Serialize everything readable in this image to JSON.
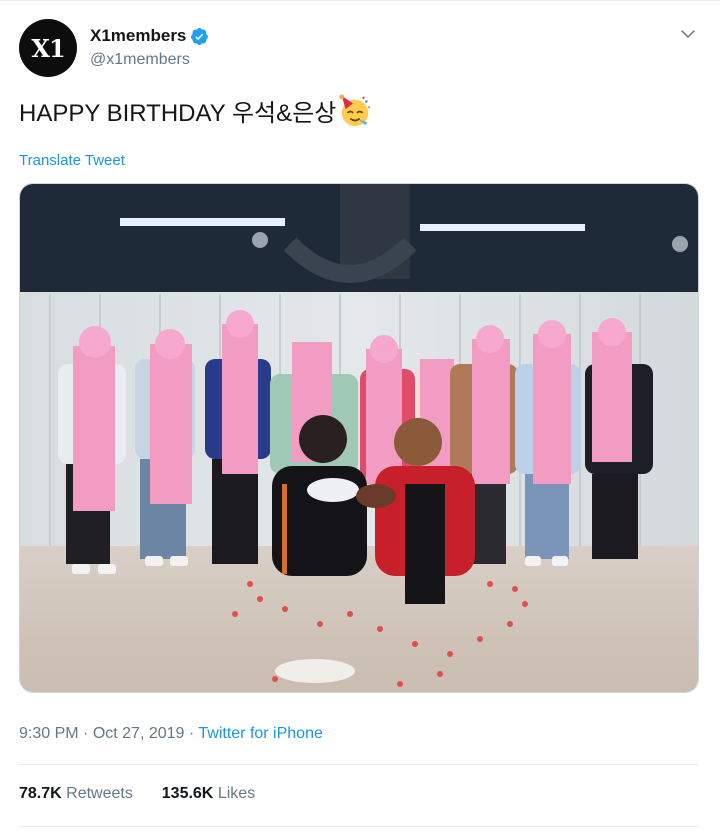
{
  "account": {
    "display_name": "X1members",
    "handle": "@x1members",
    "avatar_text": "X1"
  },
  "tweet": {
    "text": "HAPPY BIRTHDAY 우석&은상",
    "emoji": "partying-face-icon",
    "translate_label": "Translate Tweet",
    "time": "9:30 PM",
    "date": "Oct 27, 2019",
    "source": "Twitter for iPhone",
    "separator": " · "
  },
  "stats": {
    "retweets_count": "78.7K",
    "retweets_label": "Retweets",
    "likes_count": "135.6K",
    "likes_label": "Likes"
  },
  "colors": {
    "link": "#1b95e0",
    "verified": "#1da1f2",
    "secondary_text": "#657786"
  }
}
